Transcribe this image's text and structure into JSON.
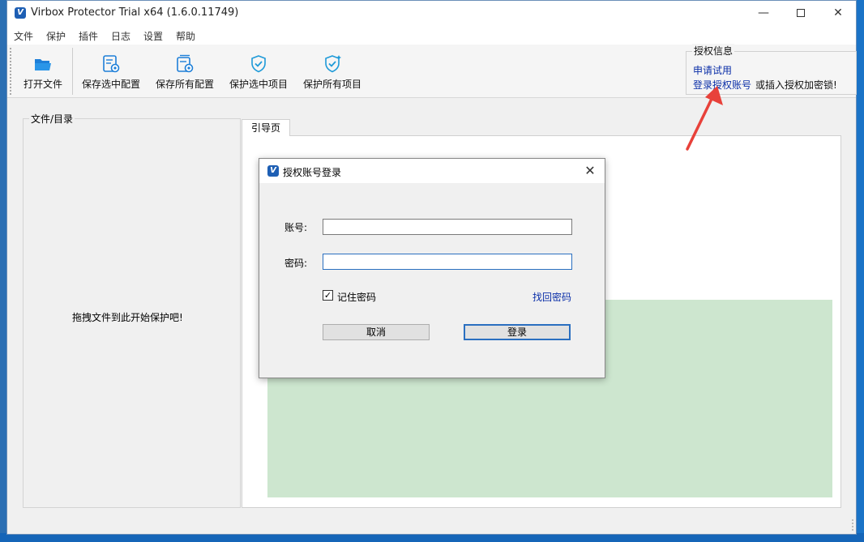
{
  "window": {
    "title": "Virbox Protector Trial x64  (1.6.0.11749)",
    "app_icon": "V",
    "minimize": "—",
    "close": "✕"
  },
  "menu": [
    "文件",
    "保护",
    "插件",
    "日志",
    "设置",
    "帮助"
  ],
  "toolbar": {
    "open_file": "打开文件",
    "save_selected": "保存选中配置",
    "save_all": "保存所有配置",
    "protect_selected": "保护选中项目",
    "protect_all": "保护所有项目"
  },
  "auth": {
    "legend": "授权信息",
    "apply_trial": "申请试用",
    "login_account": "登录授权账号",
    "or_insert": "或插入授权加密锁!"
  },
  "files_panel": {
    "legend": "文件/目录",
    "drag_hint": "拖拽文件到此开始保护吧!"
  },
  "tabs": [
    "引导页"
  ],
  "dialog": {
    "title": "授权账号登录",
    "icon": "V",
    "close": "✕",
    "account_label": "账号:",
    "account_value": "",
    "password_label": "密码:",
    "password_value": "",
    "remember_label": "记住密码",
    "remember_checked": "✓",
    "forgot_link": "找回密码",
    "cancel": "取消",
    "login": "登录"
  },
  "colors": {
    "link": "#0b2fa8",
    "accent": "#2a6fc0",
    "guide_fill": "#cde6cf",
    "arrow": "#e8413a"
  }
}
